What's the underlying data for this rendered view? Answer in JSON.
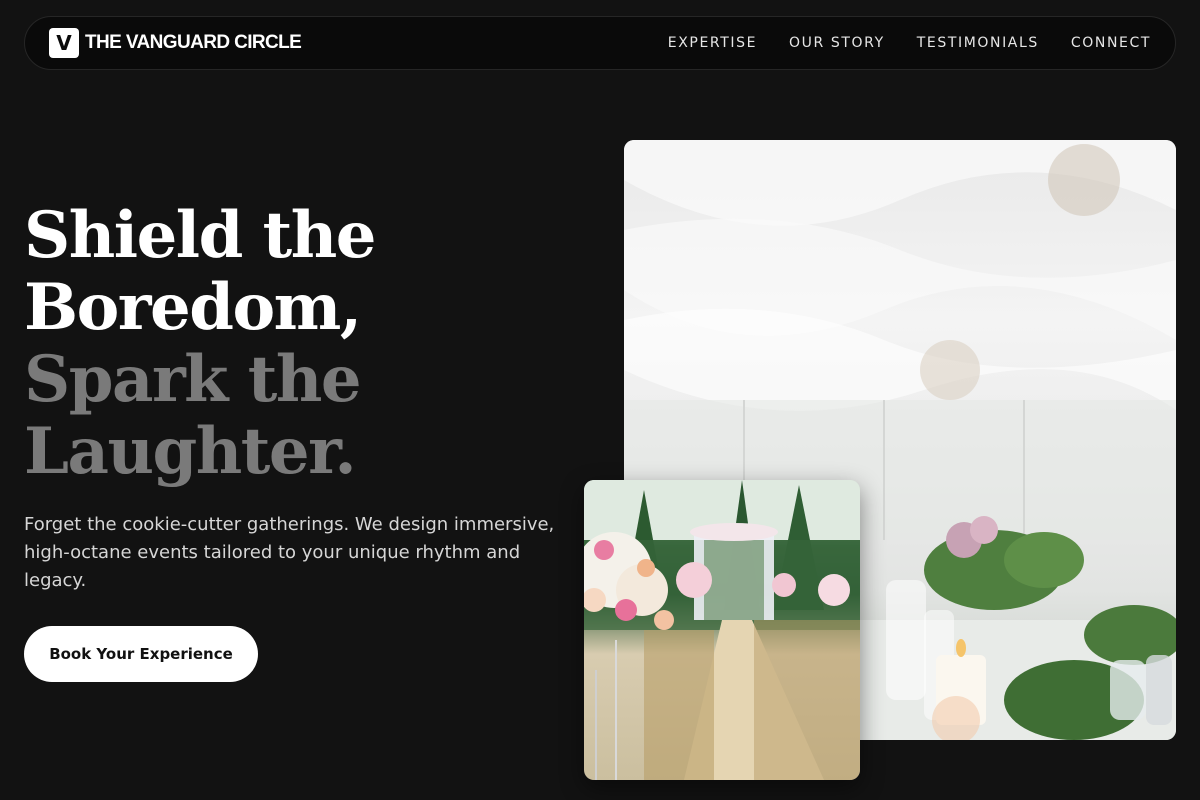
{
  "nav": {
    "logo_letter": "V",
    "brand": "THE VANGUARD CIRCLE",
    "items": [
      {
        "label": "EXPERTISE"
      },
      {
        "label": "OUR STORY"
      },
      {
        "label": "TESTIMONIALS"
      },
      {
        "label": "CONNECT"
      }
    ]
  },
  "hero": {
    "headline_line1": "Shield the",
    "headline_line2": "Boredom,",
    "headline_line3": "Spark the",
    "headline_line4": "Laughter.",
    "intro": "Forget the cookie-cutter gatherings. We design immersive, high-octane events tailored to your unique rhythm and legacy.",
    "cta_label": "Book Your Experience"
  },
  "colors": {
    "background": "#121212",
    "headline_primary": "#ffffff",
    "headline_muted": "#7a7a7a",
    "cta_bg": "#ffffff"
  }
}
